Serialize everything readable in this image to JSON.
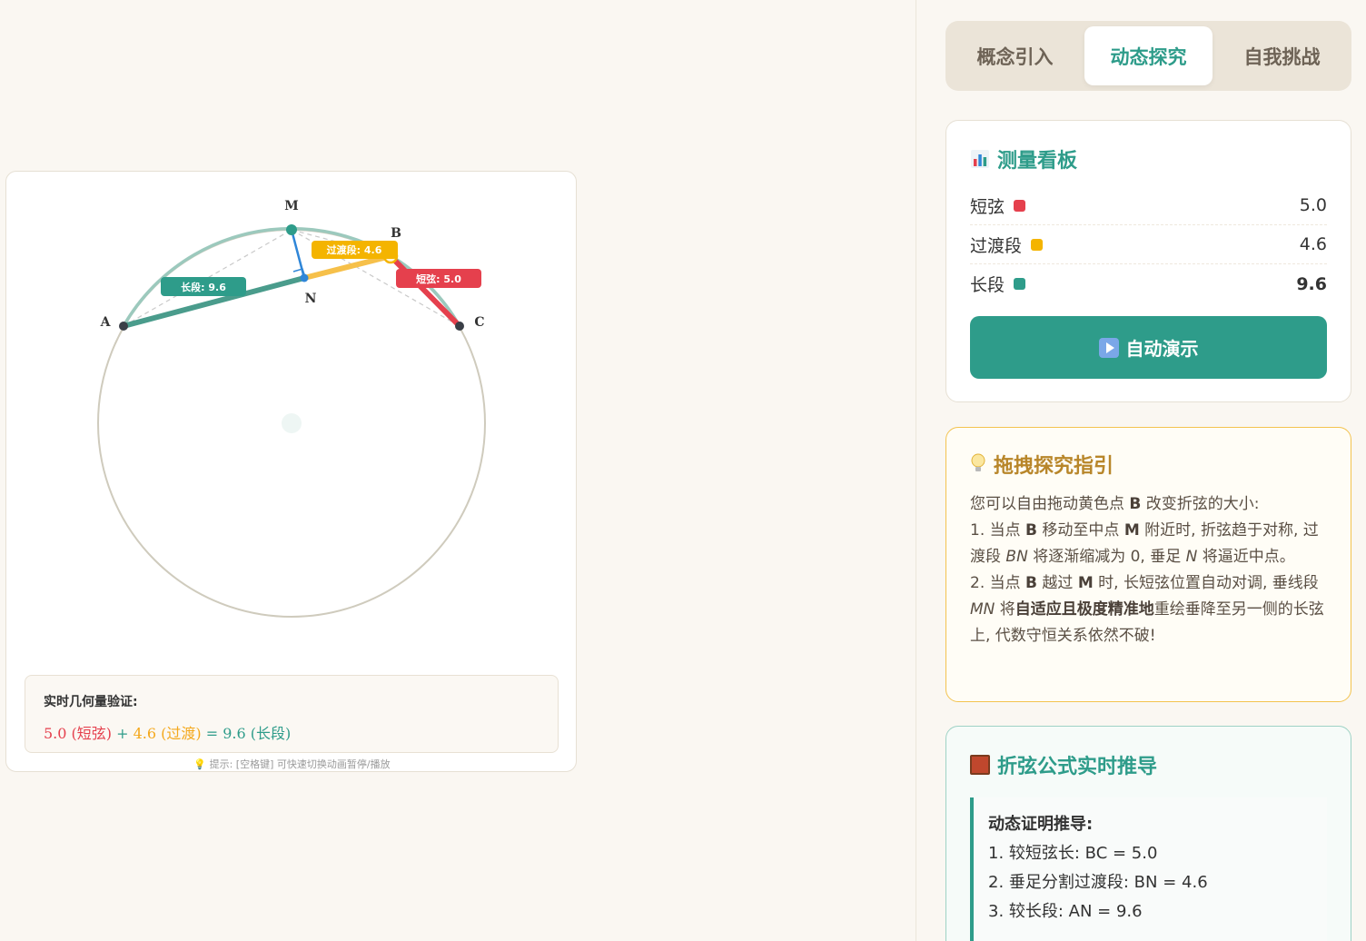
{
  "tabs": [
    {
      "label": "概念引入",
      "active": false
    },
    {
      "label": "动态探究",
      "active": true
    },
    {
      "label": "自我挑战",
      "active": false
    }
  ],
  "canvas": {
    "points": {
      "M": "M",
      "B": "B",
      "A": "A",
      "C": "C",
      "N": "N"
    },
    "labels": {
      "long": "长段: 9.6",
      "transition": "过渡段: 4.6",
      "short": "短弦: 5.0"
    },
    "verify": {
      "title": "实时几何量验证:",
      "short": "5.0 (短弦)",
      "plus": " + ",
      "trans": "4.6 (过渡)",
      "eq": " = 9.6 (长段)"
    },
    "hint": "💡 提示: [空格键] 可快速切换动画暂停/播放"
  },
  "measure": {
    "title": "测量看板",
    "rows": [
      {
        "name": "短弦",
        "value": "5.0",
        "color": "#e5404d"
      },
      {
        "name": "过渡段",
        "value": "4.6",
        "color": "#f4b400"
      },
      {
        "name": "长段",
        "value": "9.6",
        "color": "#2e9c8a"
      }
    ],
    "button": "自动演示"
  },
  "guide": {
    "title": "拖拽探究指引",
    "intro_pre": "您可以自由拖动黄色点 ",
    "intro_b": "B",
    "intro_post": " 改变折弦的大小:",
    "l1_a": "1. 当点 ",
    "l1_b": "B",
    "l1_c": " 移动至中点 ",
    "l1_d": "M",
    "l1_e": " 附近时, 折弦趋于对称, 过渡段 ",
    "l1_f": "BN",
    "l1_g": " 将逐渐缩减为 0, 垂足 ",
    "l1_h": "N",
    "l1_i": " 将逼近中点。",
    "l2_a": "2. 当点 ",
    "l2_b": "B",
    "l2_c": " 越过 ",
    "l2_d": "M",
    "l2_e": " 时, 长短弦位置自动对调, 垂线段 ",
    "l2_f": "MN",
    "l2_g": " 将",
    "l2_h": "自适应且极度精准地",
    "l2_i": "重绘垂降至另一侧的长弦上, 代数守恒关系依然不破!"
  },
  "formula": {
    "title": "折弦公式实时推导",
    "box_title": "动态证明推导:",
    "lines": [
      "1. 较短弦长: BC = 5.0",
      "2. 垂足分割过渡段: BN = 4.6",
      "3. 较长段: AN = 9.6"
    ]
  }
}
